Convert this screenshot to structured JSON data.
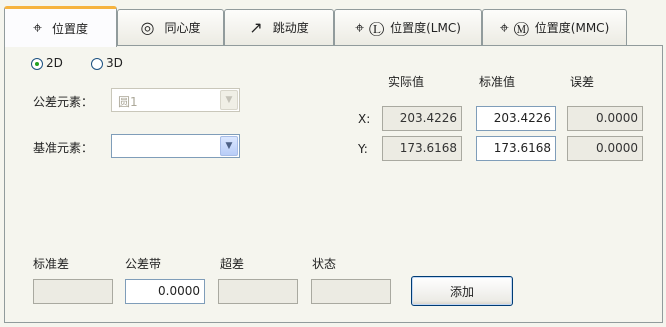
{
  "tabs": [
    {
      "icon": "⌖",
      "icon_name": "position-icon",
      "label": "位置度"
    },
    {
      "icon": "◎",
      "icon_name": "concentricity-icon",
      "label": "同心度"
    },
    {
      "icon": "↗",
      "icon_name": "runout-arrow-icon",
      "label": "跳动度"
    },
    {
      "icon": "⌖ Ⓛ",
      "icon_name": "position-lmc-icon",
      "label": "位置度(LMC)"
    },
    {
      "icon": "⌖ Ⓜ",
      "icon_name": "position-mmc-icon",
      "label": "位置度(MMC)"
    }
  ],
  "mode": {
    "option_2d": "2D",
    "option_3d": "3D",
    "selected": "2D"
  },
  "tolerance_element": {
    "label": "公差元素：",
    "value": "圆1"
  },
  "datum_element": {
    "label": "基准元素：",
    "value": ""
  },
  "results": {
    "headers": {
      "actual": "实际值",
      "nominal": "标准值",
      "error": "误差"
    },
    "x": {
      "label": "X:",
      "actual": "203.4226",
      "nominal": "203.4226",
      "error": "0.0000"
    },
    "y": {
      "label": "Y:",
      "actual": "173.6168",
      "nominal": "173.6168",
      "error": "0.0000"
    }
  },
  "bottom": {
    "std_dev_label": "标准差",
    "tolerance_band_label": "公差带",
    "tolerance_band_value": "0.0000",
    "out_of_tol_label": "超差",
    "status_label": "状态",
    "add_button": "添加"
  },
  "colors": {
    "active_tab_accent": "#f6b33f",
    "radio_dot": "#21a121"
  }
}
